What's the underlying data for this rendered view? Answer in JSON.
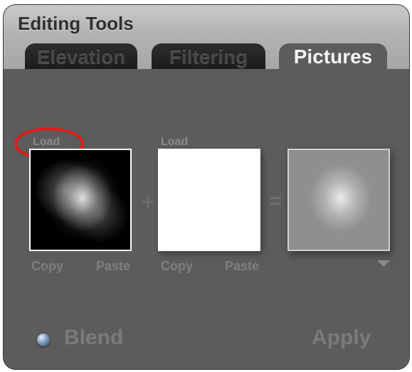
{
  "panel": {
    "title": "Editing Tools",
    "tabs": [
      {
        "label": "Elevation",
        "active": false
      },
      {
        "label": "Filtering",
        "active": false
      },
      {
        "label": "Pictures",
        "active": true
      }
    ]
  },
  "pictures": {
    "source1": {
      "load_label": "Load",
      "copy_label": "Copy",
      "paste_label": "Paste"
    },
    "source2": {
      "load_label": "Load",
      "copy_label": "Copy",
      "paste_label": "Paste"
    },
    "plus_symbol": "+",
    "equals_symbol": "=",
    "blend_label": "Blend",
    "apply_label": "Apply"
  },
  "colors": {
    "panel_bg": "#5c5c5c",
    "header_bg": "#b3b3b3",
    "highlight": "#e21a1a",
    "disabled_text": "#7a7a7a"
  },
  "icons": [
    "dropdown-arrow-icon",
    "radio-button-icon"
  ]
}
